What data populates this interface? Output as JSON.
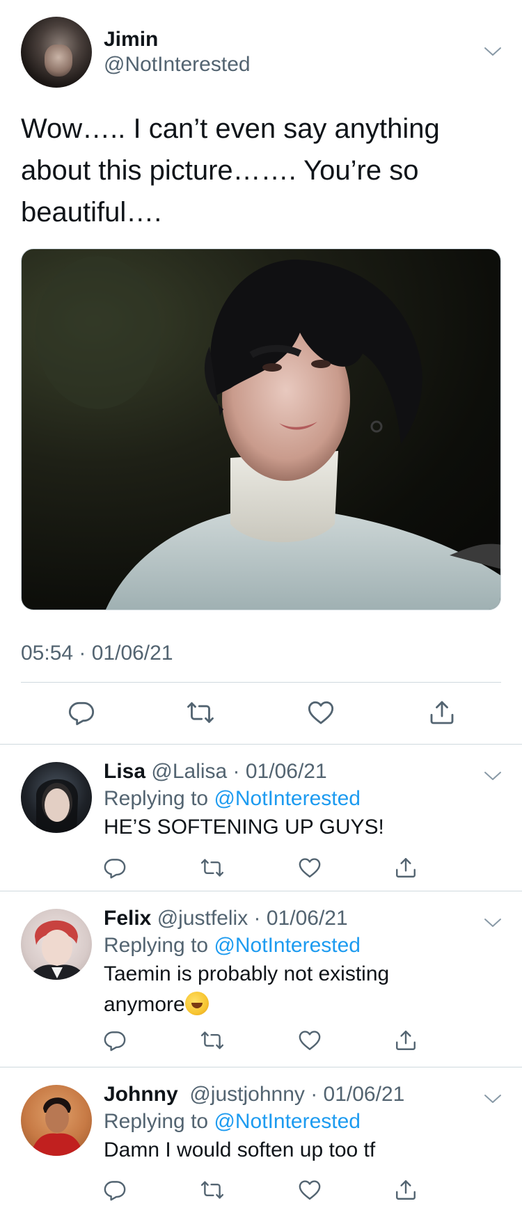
{
  "main": {
    "name": "Jimin",
    "handle": "@NotInterested",
    "text": "Wow….. I can’t even say anything about this picture……. You’re so beautiful….",
    "timestamp": "05:54 · 01/06/21"
  },
  "replies": [
    {
      "name": "Lisa",
      "handle_date": "@Lalisa · 01/06/21",
      "replying_prefix": "Replying to",
      "replying_to": "@NotInterested",
      "text": "HE’S SOFTENING UP GUYS!"
    },
    {
      "name": "Felix",
      "handle_date": "@justfelix · 01/06/21",
      "replying_prefix": "Replying to",
      "replying_to": "@NotInterested",
      "text_line1": "Taemin is probably not existing",
      "text_line2": "anymore"
    },
    {
      "name": "Johnny",
      "handle_date": "@justjohnny · 01/06/21",
      "replying_prefix": "Replying to",
      "replying_to": "@NotInterested",
      "text": "Damn I would soften up too tf"
    }
  ],
  "icons": {
    "reply": "reply-icon",
    "retweet": "retweet-icon",
    "like": "heart-icon",
    "share": "share-icon",
    "more": "chevron-down-icon"
  },
  "colors": {
    "text": "#0f1419",
    "secondary": "#536471",
    "accent": "#1d9bf0",
    "divider": "#cfd9de"
  }
}
